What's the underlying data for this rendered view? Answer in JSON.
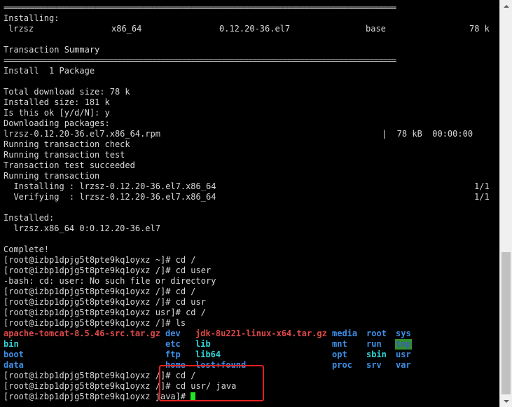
{
  "separator": "==========================================================================================",
  "pkg_table": {
    "section": "Installing:",
    "name": "lrzsz",
    "arch": "x86_64",
    "version": "0.12.20-36.el7",
    "repo": "base",
    "size": "78 k"
  },
  "summary": {
    "title": "Transaction Summary",
    "install_line": "Install  1 Package"
  },
  "log_lines": [
    "Total download size: 78 k",
    "Installed size: 181 k",
    "Is this ok [y/d/N]: y",
    "Downloading packages:"
  ],
  "download": {
    "file": "lrzsz-0.12.20-36.el7.x86_64.rpm",
    "stats": "|  78 kB  00:00:00"
  },
  "transaction_lines": [
    "Running transaction check",
    "Running transaction test",
    "Transaction test succeeded",
    "Running transaction"
  ],
  "progress": [
    {
      "text": "  Installing : lrzsz-0.12.20-36.el7.x86_64",
      "count": "1/1"
    },
    {
      "text": "  Verifying  : lrzsz-0.12.20-36.el7.x86_64",
      "count": "1/1"
    }
  ],
  "installed": {
    "title": "Installed:",
    "item": "  lrzsz.x86_64 0:0.12.20-36.el7"
  },
  "complete": "Complete!",
  "commands": [
    "[root@izbp1dpjg5t8pte9kq1oyxz ~]# cd /",
    "[root@izbp1dpjg5t8pte9kq1oyxz /]# cd user",
    "-bash: cd: user: No such file or directory",
    "[root@izbp1dpjg5t8pte9kq1oyxz /]# cd /",
    "[root@izbp1dpjg5t8pte9kq1oyxz /]# cd usr",
    "[root@izbp1dpjg5t8pte9kq1oyxz usr]# cd /",
    "[root@izbp1dpjg5t8pte9kq1oyxz /]# ls"
  ],
  "ls_output": {
    "row1": [
      "apache-tomcat-8.5.46-src.tar.gz",
      "dev",
      "jdk-8u221-linux-x64.tar.gz",
      "media",
      "root",
      "sys"
    ],
    "row2": [
      "bin",
      "etc",
      "lib",
      "mnt",
      "run",
      "tmp"
    ],
    "row3": [
      "boot",
      "ftp",
      "lib64",
      "opt",
      "sbin",
      "usr"
    ],
    "row4": [
      "data",
      "home",
      "lost+found",
      "proc",
      "srv",
      "var"
    ]
  },
  "final_commands": [
    "[root@izbp1dpjg5t8pte9kq1oyxz /]# cd /",
    "[root@izbp1dpjg5t8pte9kq1oyxz /]# cd usr/ java",
    "[root@izbp1dpjg5t8pte9kq1oyxz java]# "
  ],
  "colors": {
    "archive": "#e04848",
    "directory": "#3d8fe6",
    "symlink": "#34d4d4",
    "cursor": "#22e622",
    "highlight": "#e02020"
  }
}
